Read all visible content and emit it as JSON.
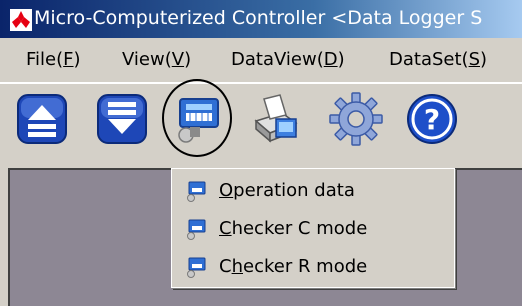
{
  "window": {
    "title": "Micro-Computerized Controller <Data Logger S"
  },
  "menubar": {
    "items": [
      {
        "label": "File(",
        "accel": "F",
        "tail": ")"
      },
      {
        "label": "View(",
        "accel": "V",
        "tail": ")"
      },
      {
        "label": "DataView(",
        "accel": "D",
        "tail": ")"
      },
      {
        "label": "DataSet(",
        "accel": "S",
        "tail": ")"
      }
    ]
  },
  "toolbar": {
    "buttons": [
      {
        "icon": "eject-up-icon"
      },
      {
        "icon": "eject-down-icon"
      },
      {
        "icon": "computer-keyboard-icon",
        "highlighted": true
      },
      {
        "icon": "printer-icon"
      },
      {
        "icon": "gear-icon"
      },
      {
        "icon": "help-icon"
      }
    ]
  },
  "dropdown": {
    "items": [
      {
        "accel": "O",
        "rest": "peration data"
      },
      {
        "accel": "C",
        "rest": "hecker C mode"
      },
      {
        "pre": "C",
        "accel": "h",
        "rest": "ecker R mode"
      }
    ]
  },
  "colors": {
    "titlebar": "#0a246a",
    "workspace": "#8d8794",
    "face": "#d4d0c8"
  }
}
